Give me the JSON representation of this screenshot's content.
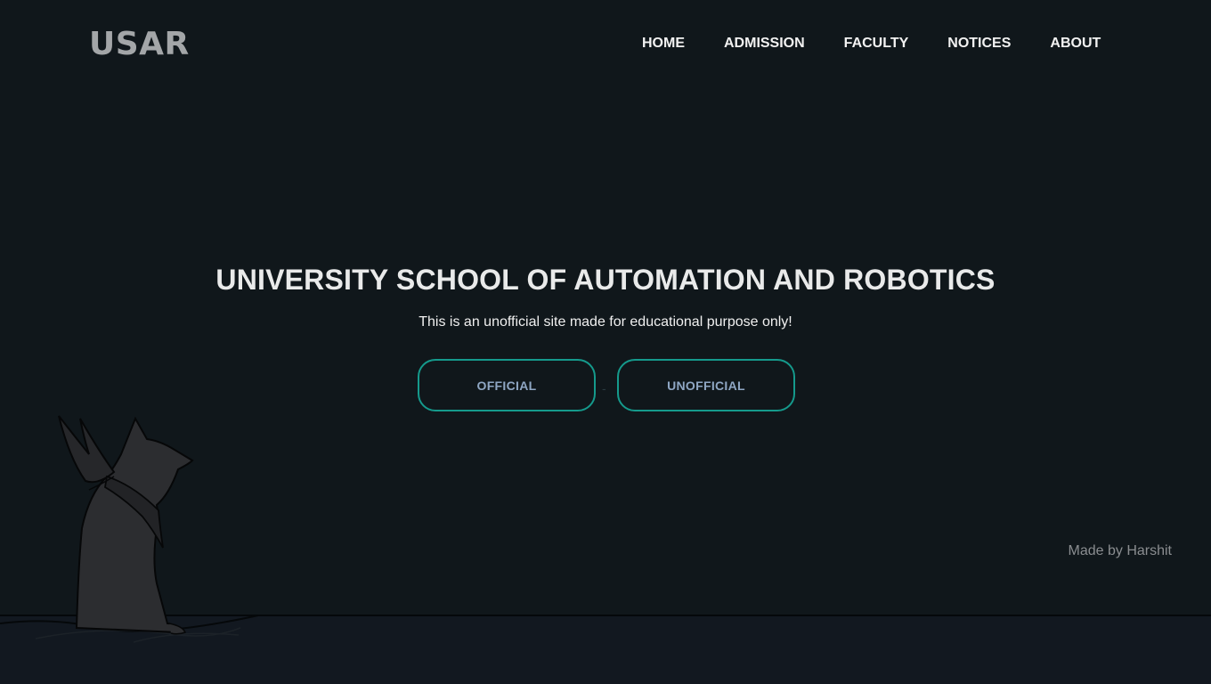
{
  "header": {
    "logo": "USAR",
    "nav": [
      {
        "label": "HOME"
      },
      {
        "label": "ADMISSION"
      },
      {
        "label": "FACULTY"
      },
      {
        "label": "NOTICES"
      },
      {
        "label": "ABOUT"
      }
    ]
  },
  "hero": {
    "title": "UNIVERSITY SCHOOL OF AUTOMATION AND ROBOTICS",
    "subtitle": "This is an unofficial site made for educational purpose only!",
    "buttons": {
      "official": "OFFICIAL",
      "unofficial": "UNOFFICIAL"
    },
    "separator": "-"
  },
  "footer": {
    "credit": "Made by Harshit"
  },
  "colors": {
    "background": "#10171b",
    "button_border": "#159a8c",
    "button_text": "#8fa7c4",
    "logo": "#a3a6a8"
  },
  "illustration": {
    "icon": "cat-silhouette-icon"
  }
}
